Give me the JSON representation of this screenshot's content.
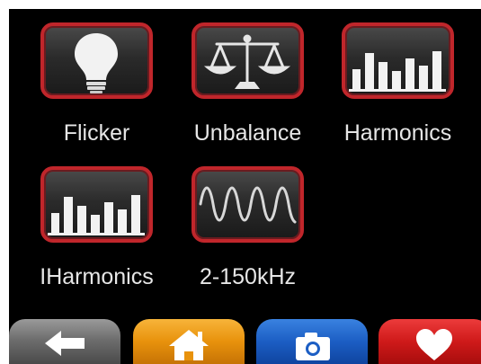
{
  "menu": {
    "tiles": [
      {
        "label": "Flicker",
        "icon": "lightbulb-icon"
      },
      {
        "label": "Unbalance",
        "icon": "balance-scale-icon"
      },
      {
        "label": "Harmonics",
        "icon": "bar-chart-icon"
      },
      {
        "label": "IHarmonics",
        "icon": "bar-chart-icon"
      },
      {
        "label": "2-150kHz",
        "icon": "sine-wave-icon"
      }
    ]
  },
  "navbar": {
    "buttons": [
      {
        "icon": "arrow-left-icon",
        "color": "#6e6e6e"
      },
      {
        "icon": "home-icon",
        "color": "#e8920c"
      },
      {
        "icon": "camera-icon",
        "color": "#1c5ec4"
      },
      {
        "icon": "heart-icon",
        "color": "#cf1a1a"
      }
    ]
  },
  "colors": {
    "background": "#000000",
    "tile_border": "#c0262b",
    "label_text": "#e6e6e6"
  }
}
